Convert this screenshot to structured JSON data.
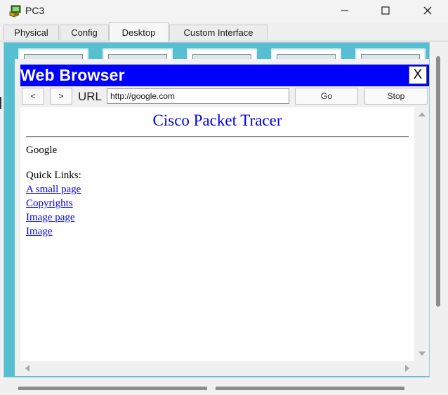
{
  "window": {
    "title": "PC3"
  },
  "tabs": [
    {
      "label": "Physical"
    },
    {
      "label": "Config"
    },
    {
      "label": "Desktop"
    },
    {
      "label": "Custom Interface"
    }
  ],
  "active_tab": "Desktop",
  "browser": {
    "title": "Web Browser",
    "close_label": "X",
    "back_label": "<",
    "forward_label": ">",
    "url_label": "URL",
    "url_value": "http://google.com",
    "go_label": "Go",
    "stop_label": "Stop"
  },
  "page": {
    "heading": "Cisco Packet Tracer",
    "text": "Google",
    "quick_links_label": "Quick Links:",
    "links": [
      {
        "label": "A small page"
      },
      {
        "label": "Copyrights"
      },
      {
        "label": "Image page"
      },
      {
        "label": "Image"
      }
    ]
  },
  "colors": {
    "browser_header": "#0000ff",
    "desktop_background": "#57bfd2",
    "link": "#0000ee"
  }
}
